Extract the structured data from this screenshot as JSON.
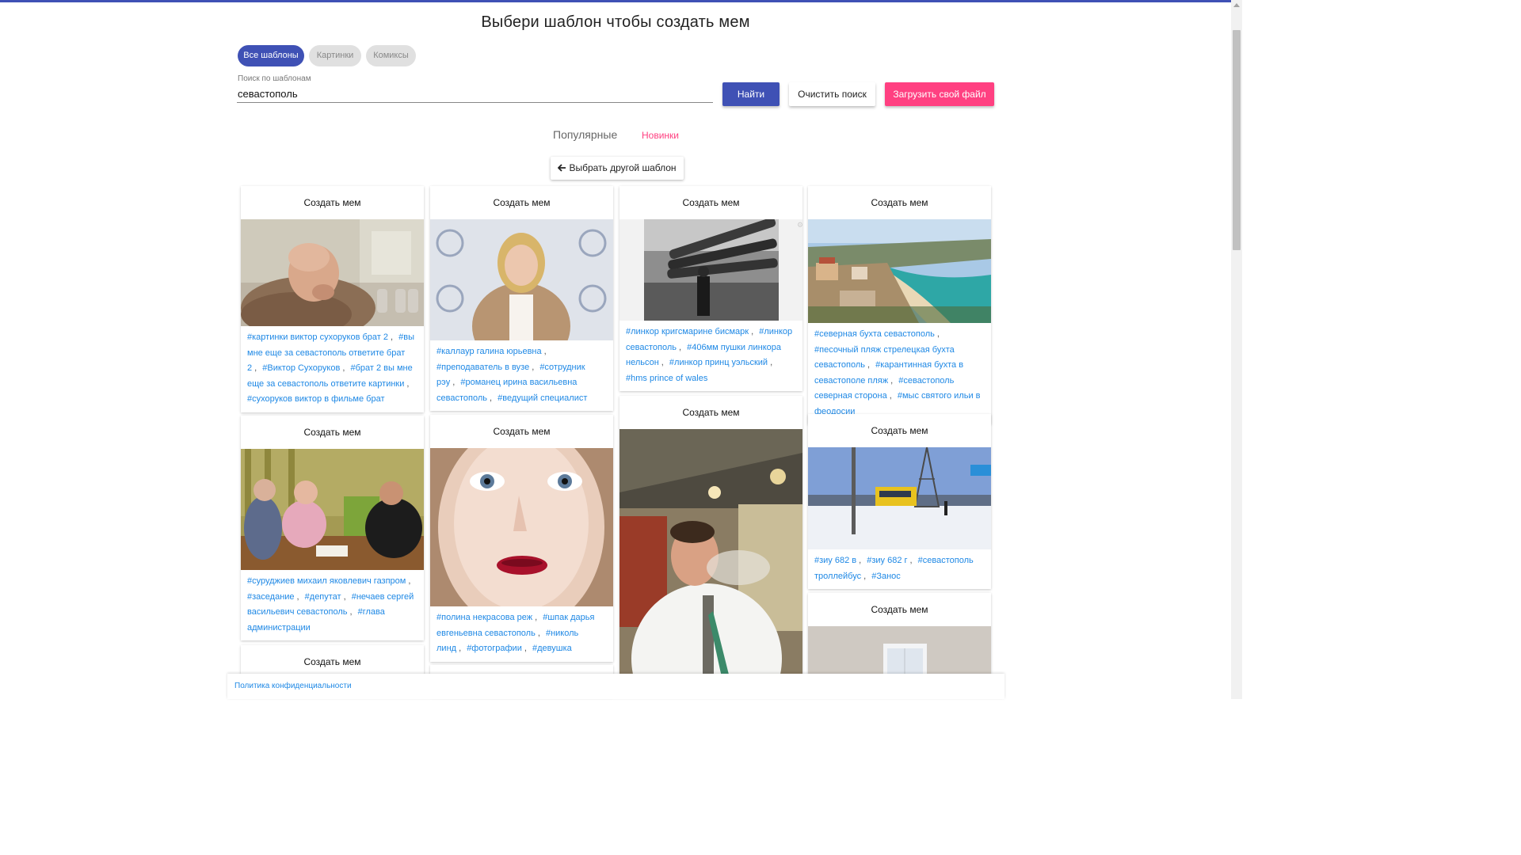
{
  "page": {
    "title": "Выбери шаблон чтобы создать мем",
    "accent_color": "#3f51b5",
    "pink_color": "#ff4081",
    "link_color": "#1e88e5"
  },
  "filters": {
    "chips": [
      "Все шаблоны",
      "Картинки",
      "Комиксы"
    ],
    "active": "Все шаблоны"
  },
  "search": {
    "label": "Поиск по шаблонам",
    "value": "севастополь",
    "find_label": "Найти",
    "clear_label": "Очистить поиск",
    "upload_label": "Загрузить свой файл"
  },
  "sort": {
    "popular": "Популярные",
    "new": "Новинки"
  },
  "back_button": {
    "icon": "arrow-left-icon",
    "label": "Выбрать другой шаблон"
  },
  "cards": [
    {
      "title": "Создать мем",
      "image": "bald man in sweater in restroom",
      "tags": [
        "#картинки виктор сухоруков брат 2",
        "#вы мне еще за севастополь ответите брат 2",
        "#Виктор Сухоруков",
        "#брат 2 вы мне еще за севастополь ответите картинки",
        "#сухоруков виктор в фильме брат"
      ]
    },
    {
      "title": "Создать мем",
      "image": "smiling woman in beige vest",
      "tags": [
        "#каллаур галина юрьевна",
        "#преподаватель в вузе",
        "#сотрудник рэу",
        "#романец ирина васильевна севастополь",
        "#ведущий специалист"
      ]
    },
    {
      "title": "Создать мем",
      "image": "black and white battleship guns",
      "tags": [
        "#линкор кригсмарине бисмарк",
        "#линкор севастополь",
        "#406мм пушки линкора нельсон",
        "#линкор принц уэльский",
        "#hms prince of wales"
      ]
    },
    {
      "title": "Создать мем",
      "image": "coastal bay with beach and town",
      "tags": [
        "#северная бухта севастополь",
        "#песочный пляж стрелецкая бухта севастополь",
        "#карантинная бухта в севастополе пляж",
        "#севастополь северная сторона",
        "#мыс святого ильи в феодосии"
      ]
    },
    {
      "title": "Создать мем",
      "image": "three men at a meeting table",
      "tags": [
        "#суруджиев михаил яковлевич газпром",
        "#заседание",
        "#депутат",
        "#нечаев сергей васильевич севастополь",
        "#глава администрации"
      ]
    },
    {
      "title": "Создать мем",
      "image": "close-up face with red lips",
      "tags": [
        "#полина некрасова реж",
        "#шпак дарья евгеньевна севастополь",
        "#николь линд",
        "#фотографии",
        "#девушка"
      ]
    },
    {
      "title": "Создать мем",
      "image": "man in white shirt with hookah",
      "tags": []
    },
    {
      "title": "Создать мем",
      "image": "snowy street with trolleybus",
      "tags": [
        "#зиу 682 в",
        "#зиу 682 г",
        "#севастополь троллейбус",
        "#Занос"
      ]
    },
    {
      "title": "Создать мем",
      "image": "bright room with window",
      "tags": []
    },
    {
      "title": "Создать мем",
      "image": "",
      "tags": []
    }
  ],
  "footer": {
    "privacy_link": "Политика конфиденциальности"
  }
}
